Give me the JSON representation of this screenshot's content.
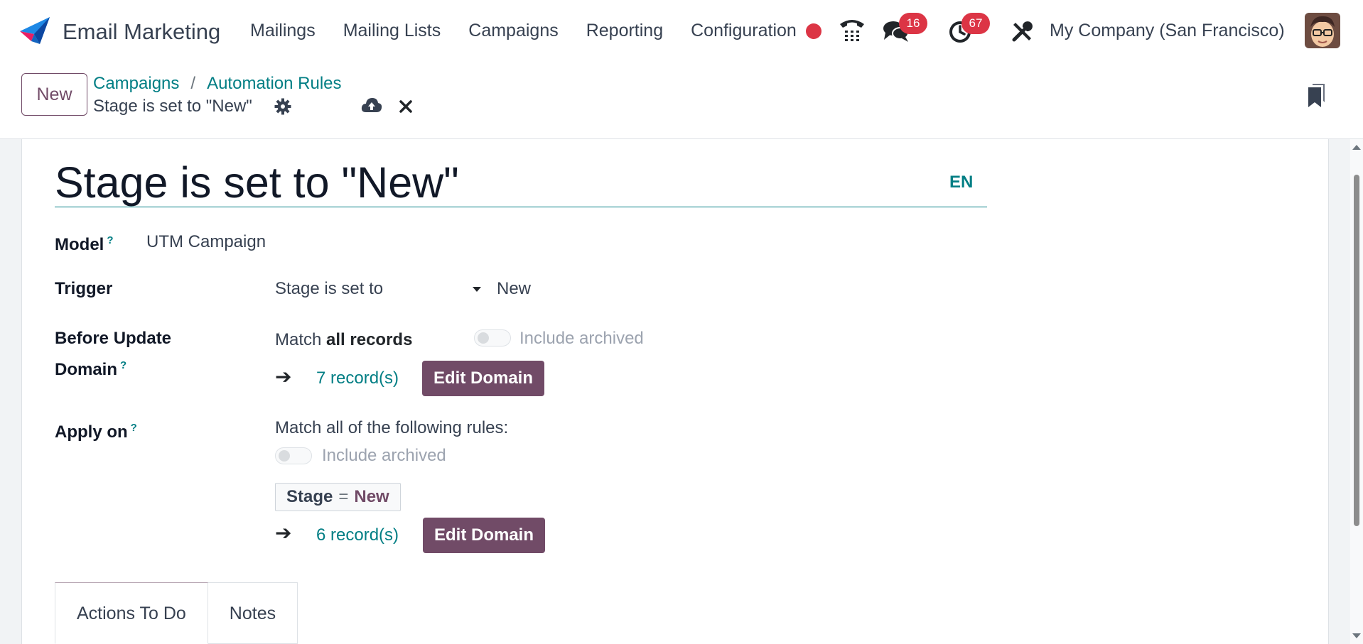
{
  "navbar": {
    "app_name": "Email Marketing",
    "menu": [
      "Mailings",
      "Mailing Lists",
      "Campaigns",
      "Reporting",
      "Configuration"
    ],
    "messages_count": "16",
    "activities_count": "67",
    "company": "My Company (San Francisco)",
    "icons": [
      "brand-logo-icon",
      "phone-icon",
      "chat-icon",
      "clock-icon",
      "tools-icon",
      "avatar"
    ],
    "colors": {
      "badge": "#dc3545",
      "recording": "#dc3545"
    }
  },
  "control_panel": {
    "new_label": "New",
    "breadcrumb": [
      "Campaigns",
      "Automation Rules"
    ],
    "breadcrumb_separator": "/",
    "current": "Stage is set to \"New\"",
    "icons": [
      "gear-icon",
      "cloud-upload-icon",
      "discard-icon",
      "bookmark-icon"
    ]
  },
  "form": {
    "title": "Stage is set to \"New\"",
    "lang": "EN",
    "model_label": "Model",
    "model_value": "UTM Campaign",
    "trigger_label": "Trigger",
    "trigger_value": "Stage is set to",
    "trigger_target": "New",
    "before_update_label_line1": "Before Update",
    "before_update_label_line2": "Domain",
    "before_match_prefix": "Match",
    "before_match_bold": "all records",
    "include_archived": "Include archived",
    "before_records": "7 record(s)",
    "edit_domain": "Edit Domain",
    "apply_on_label": "Apply on",
    "apply_match_text": "Match all of the following rules:",
    "rule_field": "Stage",
    "rule_operator": "=",
    "rule_value": "New",
    "apply_records": "6 record(s)",
    "help_marker": "?",
    "colors": {
      "primary": "#714b67",
      "link": "#017e84"
    }
  },
  "tabs": [
    {
      "label": "Actions To Do",
      "active": true
    },
    {
      "label": "Notes",
      "active": false
    }
  ]
}
